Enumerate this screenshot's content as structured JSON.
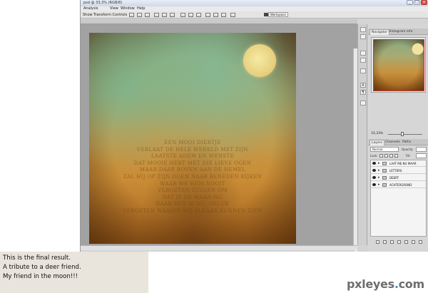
{
  "window": {
    "title": "psd @ 33,3% (RGB/8)",
    "controls": {
      "minimize": "_",
      "maximize": "□",
      "close": "×"
    }
  },
  "menu": {
    "items": [
      "Analysis",
      "View",
      "Window",
      "Help"
    ]
  },
  "options_bar": {
    "transform_label": "Show Transform Controls",
    "workspace_label": "Workspace"
  },
  "artwork": {
    "poem_lines": [
      "EEN MOOI DIERTJE",
      "VERLAAT DE HELE WERELD MET ZIJN",
      "LAATSTE ADEM EN WENSTE",
      "DAT MOOIE HERT MET DIE LIEVE OGEN",
      "MAAR DAAR BOVEN AAN DE HEMEL",
      "ZAL HIJ OP ZIJN OGEN NAAR BENEDEN KIJKEN",
      "WAAR WE HEM NOOIT",
      "VERGETEN ZULLEN OM",
      "DAT IS DE MAAN NU",
      "DAAR BEN IK NU, GELIJK",
      "VERGETEN WAARIN WIJ ELKAAR KUNNEN ZIEN"
    ]
  },
  "mini_dock": {
    "tools": [
      "double-arrow",
      "info",
      "scissors",
      "pin",
      "brush",
      "text-A",
      "paragraph",
      "layers"
    ]
  },
  "navigator_panel": {
    "tabs": [
      "Navigator",
      "Histogram",
      "Info"
    ],
    "zoom": "33,33%"
  },
  "layers_panel": {
    "tabs": [
      "Layers",
      "Channels",
      "Paths"
    ],
    "blend_mode": "Normal",
    "opacity_label": "Opacity:",
    "lock_label": "Lock:",
    "fill_label": "Fill:",
    "layers": [
      {
        "name": "LAAT ME NU MAAR",
        "visible": true
      },
      {
        "name": "LETTERS",
        "visible": true
      },
      {
        "name": "DEERT",
        "visible": true
      },
      {
        "name": "ACHTERGROND",
        "visible": true
      }
    ]
  },
  "caption": {
    "lines": [
      "This is the final result.",
      "A tribute to a deer friend.",
      "My friend in the moon!!!"
    ]
  },
  "watermark": {
    "text": "pxleyes",
    "dot": ".",
    "tld": "com"
  },
  "colors": {
    "canvas_bg": "#a2a2a2",
    "panel_bg": "#d6d6d6",
    "caption_bg": "#e9e4dc",
    "watermark_accent": "#2f9bd6"
  }
}
